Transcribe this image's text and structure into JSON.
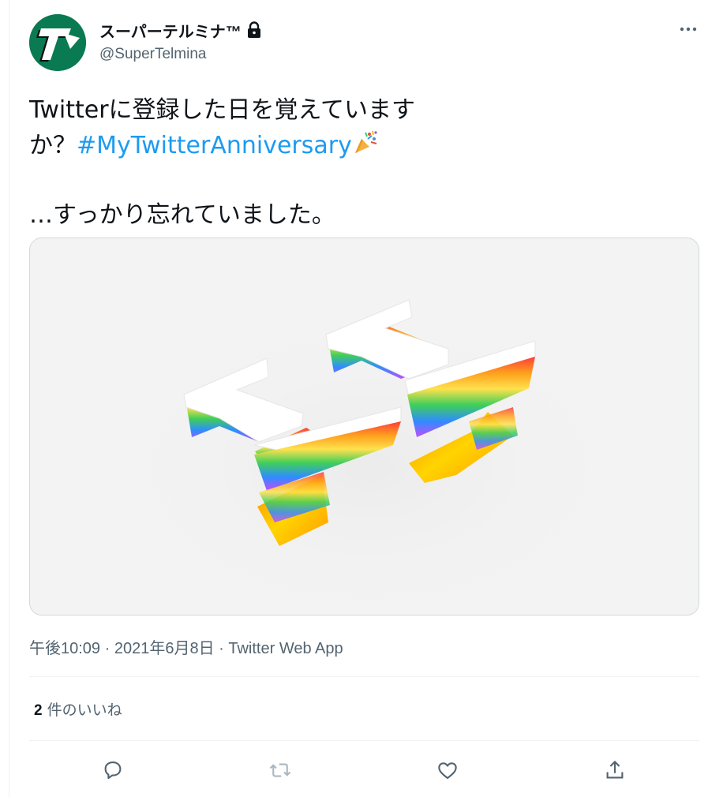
{
  "author": {
    "display_name": "スーパーテルミナ™",
    "handle": "@SuperTelmina",
    "avatar_letter": "T"
  },
  "tweet": {
    "line1": "Twitterに登録した日を覚えていま",
    "line1_end": "す",
    "line2_prefix": "か？",
    "hashtag": "#MyTwitterAnniversary",
    "line3": "…すっかり忘れていました。"
  },
  "media": {
    "alt": "paper-cut number 11 with colorful layered edges"
  },
  "meta": {
    "time": "午後10:09",
    "sep1": " · ",
    "date": "2021年6月8日",
    "sep2": " · ",
    "source": "Twitter Web App"
  },
  "likes": {
    "count": "2",
    "label": "件のいいね"
  },
  "colors": {
    "accent": "#1d9bf0",
    "text": "#0f1419",
    "muted": "#536471",
    "avatar_bg": "#0a7a52"
  }
}
